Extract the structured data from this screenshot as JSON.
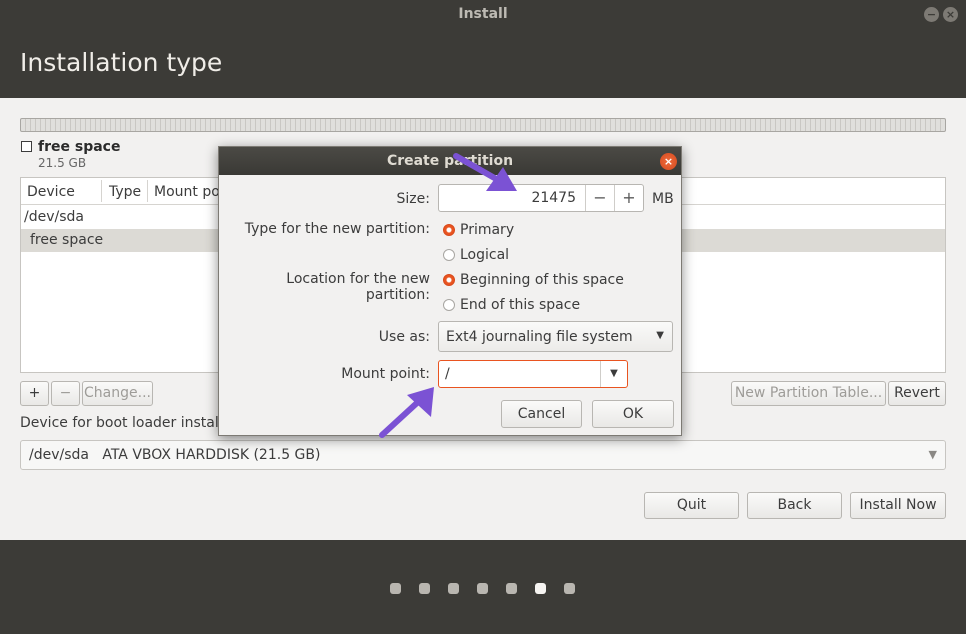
{
  "window": {
    "title": "Install"
  },
  "header": {
    "title": "Installation type"
  },
  "disk": {
    "legend_name": "free space",
    "legend_size": "21.5 GB"
  },
  "table": {
    "columns": [
      "Device",
      "Type",
      "Mount po"
    ],
    "rows": [
      {
        "device": "/dev/sda"
      },
      {
        "device": "free space"
      }
    ]
  },
  "controls": {
    "add": "+",
    "remove": "−",
    "change": "Change...",
    "new_partition_table": "New Partition Table...",
    "revert": "Revert"
  },
  "boot": {
    "label": "Device for boot loader installa",
    "device": "/dev/sda",
    "description": "ATA VBOX HARDDISK (21.5 GB)"
  },
  "actions": {
    "quit": "Quit",
    "back": "Back",
    "install": "Install Now"
  },
  "dialog": {
    "title": "Create partition",
    "size_label": "Size:",
    "size_value": "21475",
    "size_unit": "MB",
    "type_label": "Type for the new partition:",
    "type_options": [
      "Primary",
      "Logical"
    ],
    "type_selected": "Primary",
    "location_label": "Location for the new partition:",
    "location_options": [
      "Beginning of this space",
      "End of this space"
    ],
    "location_selected": "Beginning of this space",
    "use_as_label": "Use as:",
    "use_as_value": "Ext4 journaling file system",
    "mount_label": "Mount point:",
    "mount_value": "/",
    "cancel": "Cancel",
    "ok": "OK"
  },
  "progress": {
    "total_steps": 7,
    "current_step": 6
  },
  "colors": {
    "accent": "#e95420",
    "annotation_arrow": "#7b52d4"
  }
}
